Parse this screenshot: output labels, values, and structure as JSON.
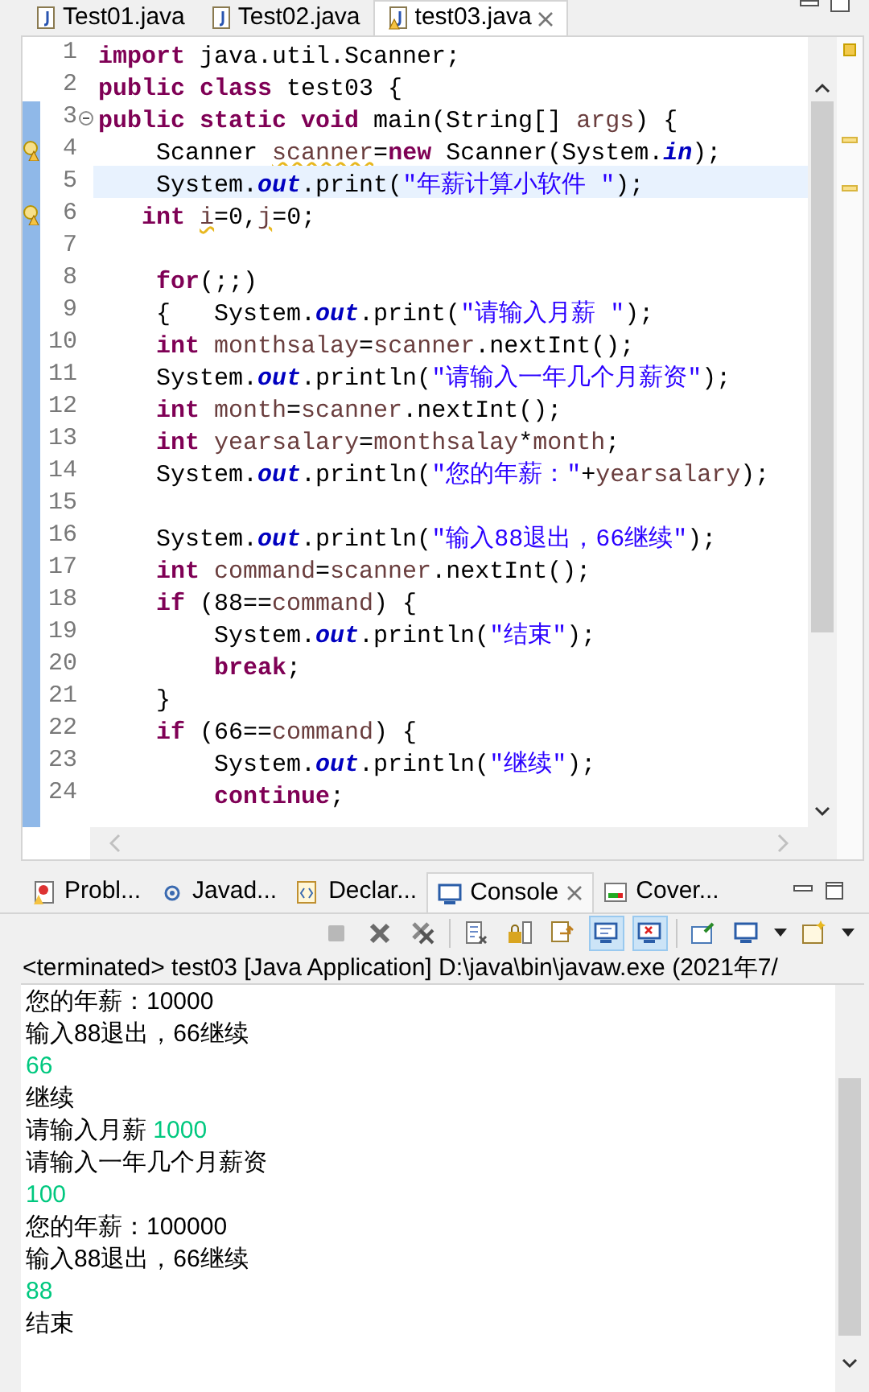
{
  "editor_tabs": [
    {
      "label": "Test01.java",
      "selected": false,
      "warning": false
    },
    {
      "label": "Test02.java",
      "selected": false,
      "warning": false
    },
    {
      "label": "test03.java",
      "selected": true,
      "warning": true
    }
  ],
  "code_lines": [
    {
      "number": "1",
      "warning": false,
      "foldable": false,
      "highlighted": false,
      "tokens": [
        {
          "kind": "kw",
          "text": "import"
        },
        {
          "kind": "plain",
          "text": " java.util.Scanner;"
        }
      ]
    },
    {
      "number": "2",
      "warning": false,
      "foldable": false,
      "highlighted": false,
      "tokens": [
        {
          "kind": "kw",
          "text": "public class"
        },
        {
          "kind": "plain",
          "text": " test03 {"
        }
      ]
    },
    {
      "number": "3",
      "warning": false,
      "foldable": true,
      "highlighted": false,
      "tokens": [
        {
          "kind": "kw",
          "text": "public static void"
        },
        {
          "kind": "plain",
          "text": " main(String[] "
        },
        {
          "kind": "var",
          "text": "args"
        },
        {
          "kind": "plain",
          "text": ") {"
        }
      ]
    },
    {
      "number": "4",
      "foldable": false,
      "warning": true,
      "highlighted": false,
      "tokens": [
        {
          "kind": "plain",
          "text": "    Scanner "
        },
        {
          "kind": "warnvar",
          "text": "scanner"
        },
        {
          "kind": "plain",
          "text": "="
        },
        {
          "kind": "kw",
          "text": "new"
        },
        {
          "kind": "plain",
          "text": " Scanner(System."
        },
        {
          "kind": "field",
          "text": "in"
        },
        {
          "kind": "plain",
          "text": ");"
        }
      ]
    },
    {
      "number": "5",
      "warning": false,
      "foldable": false,
      "highlighted": true,
      "tokens": [
        {
          "kind": "plain",
          "text": "    System."
        },
        {
          "kind": "field",
          "text": "out"
        },
        {
          "kind": "plain",
          "text": ".print("
        },
        {
          "kind": "str",
          "text": "\"年薪计算小软件 \""
        },
        {
          "kind": "plain",
          "text": ");"
        }
      ]
    },
    {
      "number": "6",
      "foldable": false,
      "warning": true,
      "highlighted": false,
      "tokens": [
        {
          "kind": "kw",
          "text": "   int "
        },
        {
          "kind": "warnvar",
          "text": "i"
        },
        {
          "kind": "plain",
          "text": "=0,"
        },
        {
          "kind": "warnvar",
          "text": "j"
        },
        {
          "kind": "plain",
          "text": "=0;"
        }
      ]
    },
    {
      "number": "7",
      "warning": false,
      "foldable": false,
      "highlighted": false
    },
    {
      "number": "8",
      "warning": false,
      "foldable": false,
      "highlighted": false,
      "tokens": [
        {
          "kind": "kw",
          "text": "    for"
        },
        {
          "kind": "plain",
          "text": "(;;)"
        }
      ]
    },
    {
      "number": "9",
      "warning": false,
      "foldable": false,
      "highlighted": false,
      "tokens": [
        {
          "kind": "plain",
          "text": "    {   System."
        },
        {
          "kind": "field",
          "text": "out"
        },
        {
          "kind": "plain",
          "text": ".print("
        },
        {
          "kind": "str",
          "text": "\"请输入月薪 \""
        },
        {
          "kind": "plain",
          "text": ");"
        }
      ]
    },
    {
      "number": "10",
      "warning": false,
      "foldable": false,
      "highlighted": false,
      "tokens": [
        {
          "kind": "kw",
          "text": "    int"
        },
        {
          "kind": "var",
          "text": " monthsalay"
        },
        {
          "kind": "plain",
          "text": "="
        },
        {
          "kind": "var",
          "text": "scanner"
        },
        {
          "kind": "plain",
          "text": ".nextInt();"
        }
      ]
    },
    {
      "number": "11",
      "warning": false,
      "foldable": false,
      "highlighted": false,
      "tokens": [
        {
          "kind": "plain",
          "text": "    System."
        },
        {
          "kind": "field",
          "text": "out"
        },
        {
          "kind": "plain",
          "text": ".println("
        },
        {
          "kind": "str",
          "text": "\"请输入一年几个月薪资\""
        },
        {
          "kind": "plain",
          "text": ");"
        }
      ]
    },
    {
      "number": "12",
      "warning": false,
      "foldable": false,
      "highlighted": false,
      "tokens": [
        {
          "kind": "kw",
          "text": "    int"
        },
        {
          "kind": "var",
          "text": " month"
        },
        {
          "kind": "plain",
          "text": "="
        },
        {
          "kind": "var",
          "text": "scanner"
        },
        {
          "kind": "plain",
          "text": ".nextInt();"
        }
      ]
    },
    {
      "number": "13",
      "warning": false,
      "foldable": false,
      "highlighted": false,
      "tokens": [
        {
          "kind": "kw",
          "text": "    int"
        },
        {
          "kind": "var",
          "text": " yearsalary"
        },
        {
          "kind": "plain",
          "text": "="
        },
        {
          "kind": "var",
          "text": "monthsalay"
        },
        {
          "kind": "plain",
          "text": "*"
        },
        {
          "kind": "var",
          "text": "month"
        },
        {
          "kind": "plain",
          "text": ";"
        }
      ]
    },
    {
      "number": "14",
      "warning": false,
      "foldable": false,
      "highlighted": false,
      "tokens": [
        {
          "kind": "plain",
          "text": "    System."
        },
        {
          "kind": "field",
          "text": "out"
        },
        {
          "kind": "plain",
          "text": ".println("
        },
        {
          "kind": "str",
          "text": "\"您的年薪：\""
        },
        {
          "kind": "plain",
          "text": "+"
        },
        {
          "kind": "var",
          "text": "yearsalary"
        },
        {
          "kind": "plain",
          "text": ");"
        }
      ]
    },
    {
      "number": "15",
      "warning": false,
      "foldable": false,
      "highlighted": false
    },
    {
      "number": "16",
      "warning": false,
      "foldable": false,
      "highlighted": false,
      "tokens": [
        {
          "kind": "plain",
          "text": "    System."
        },
        {
          "kind": "field",
          "text": "out"
        },
        {
          "kind": "plain",
          "text": ".println("
        },
        {
          "kind": "str",
          "text": "\"输入88退出，66继续\""
        },
        {
          "kind": "plain",
          "text": ");"
        }
      ]
    },
    {
      "number": "17",
      "warning": false,
      "foldable": false,
      "highlighted": false,
      "tokens": [
        {
          "kind": "kw",
          "text": "    int"
        },
        {
          "kind": "var",
          "text": " command"
        },
        {
          "kind": "plain",
          "text": "="
        },
        {
          "kind": "var",
          "text": "scanner"
        },
        {
          "kind": "plain",
          "text": ".nextInt();"
        }
      ]
    },
    {
      "number": "18",
      "warning": false,
      "foldable": false,
      "highlighted": false,
      "tokens": [
        {
          "kind": "kw",
          "text": "    if"
        },
        {
          "kind": "plain",
          "text": " (88=="
        },
        {
          "kind": "var",
          "text": "command"
        },
        {
          "kind": "plain",
          "text": ") {"
        }
      ]
    },
    {
      "number": "19",
      "warning": false,
      "foldable": false,
      "highlighted": false,
      "tokens": [
        {
          "kind": "plain",
          "text": "        System."
        },
        {
          "kind": "field",
          "text": "out"
        },
        {
          "kind": "plain",
          "text": ".println("
        },
        {
          "kind": "str",
          "text": "\"结束\""
        },
        {
          "kind": "plain",
          "text": ");"
        }
      ]
    },
    {
      "number": "20",
      "warning": false,
      "foldable": false,
      "highlighted": false,
      "tokens": [
        {
          "kind": "kw",
          "text": "        break"
        },
        {
          "kind": "plain",
          "text": ";"
        }
      ]
    },
    {
      "number": "21",
      "warning": false,
      "foldable": false,
      "highlighted": false,
      "tokens": [
        {
          "kind": "plain",
          "text": "    }"
        }
      ]
    },
    {
      "number": "22",
      "warning": false,
      "foldable": false,
      "highlighted": false,
      "tokens": [
        {
          "kind": "kw",
          "text": "    if"
        },
        {
          "kind": "plain",
          "text": " (66=="
        },
        {
          "kind": "var",
          "text": "command"
        },
        {
          "kind": "plain",
          "text": ") {"
        }
      ]
    },
    {
      "number": "23",
      "warning": false,
      "foldable": false,
      "highlighted": false,
      "tokens": [
        {
          "kind": "plain",
          "text": "        System."
        },
        {
          "kind": "field",
          "text": "out"
        },
        {
          "kind": "plain",
          "text": ".println("
        },
        {
          "kind": "str",
          "text": "\"继续\""
        },
        {
          "kind": "plain",
          "text": ");"
        }
      ]
    },
    {
      "number": "24",
      "warning": false,
      "foldable": false,
      "highlighted": false,
      "tokens": [
        {
          "kind": "kw",
          "text": "        continue"
        },
        {
          "kind": "plain",
          "text": ";"
        }
      ]
    }
  ],
  "panel_tabs": [
    {
      "label": "Probl...",
      "kind": "problems",
      "selected": false,
      "closable": false
    },
    {
      "label": "Javad...",
      "kind": "javadoc",
      "selected": false,
      "closable": false
    },
    {
      "label": "Declar...",
      "kind": "declaration",
      "selected": false,
      "closable": false
    },
    {
      "label": "Console",
      "kind": "console",
      "selected": true,
      "closable": true
    },
    {
      "label": "Cover...",
      "kind": "coverage",
      "selected": false,
      "closable": false
    }
  ],
  "toolbar": [
    {
      "kind": "stop",
      "selected": false
    },
    {
      "kind": "remove",
      "selected": false
    },
    {
      "kind": "remove-all",
      "selected": false
    },
    {
      "kind": "sep"
    },
    {
      "kind": "clear",
      "selected": false
    },
    {
      "kind": "lock",
      "selected": false
    },
    {
      "kind": "wrap",
      "selected": false
    },
    {
      "kind": "show-out",
      "selected": true
    },
    {
      "kind": "show-err",
      "selected": true
    },
    {
      "kind": "sep"
    },
    {
      "kind": "pin",
      "selected": false
    },
    {
      "kind": "display",
      "selected": false
    },
    {
      "kind": "caret",
      "selected": false
    },
    {
      "kind": "new",
      "selected": false
    },
    {
      "kind": "caret",
      "selected": false
    }
  ],
  "console_title": "<terminated> test03 [Java Application] D:\\java\\bin\\javaw.exe  (2021年7/",
  "console_lines": [
    [
      {
        "kind": "output",
        "text": "您的年薪：10000"
      }
    ],
    [
      {
        "kind": "output",
        "text": "输入88退出，66继续"
      }
    ],
    [
      {
        "kind": "input",
        "text": "66"
      }
    ],
    [
      {
        "kind": "output",
        "text": "继续"
      }
    ],
    [
      {
        "kind": "output",
        "text": "请输入月薪 "
      },
      {
        "kind": "input",
        "text": "1000"
      }
    ],
    [
      {
        "kind": "output",
        "text": "请输入一年几个月薪资"
      }
    ],
    [
      {
        "kind": "input",
        "text": "100"
      }
    ],
    [
      {
        "kind": "output",
        "text": "您的年薪：100000"
      }
    ],
    [
      {
        "kind": "output",
        "text": "输入88退出，66继续"
      }
    ],
    [
      {
        "kind": "input",
        "text": "88"
      }
    ],
    [
      {
        "kind": "output",
        "text": "结束"
      }
    ]
  ]
}
